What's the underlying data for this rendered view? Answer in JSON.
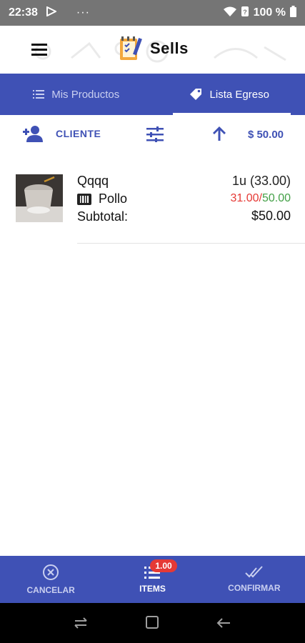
{
  "status_bar": {
    "time": "22:38",
    "overflow": "···",
    "battery_text": "100 %",
    "icons": [
      "play-store-icon",
      "wifi-icon",
      "signal-icon",
      "battery-icon"
    ]
  },
  "app_bar": {
    "title": "Sells",
    "menu_icon": "hamburger-menu-icon",
    "logo_icon": "notebook-pencil-icon"
  },
  "tabs": [
    {
      "label": "Mis Productos",
      "icon": "list-icon",
      "active": false
    },
    {
      "label": "Lista Egreso",
      "icon": "tag-icon",
      "active": true
    }
  ],
  "toolbar": {
    "cliente_label": "CLIENTE",
    "total": "$ 50.00"
  },
  "items": [
    {
      "name": "Qqqq",
      "quantity": "1u (33.00)",
      "category": "Pollo",
      "cost_price": "31.00",
      "separator": "/",
      "sale_price": "50.00",
      "subtotal_label": "Subtotal:",
      "subtotal_value": "$50.00"
    }
  ],
  "bottom_nav": {
    "cancel_label": "CANCELAR",
    "items_label": "ITEMS",
    "items_badge": "1.00",
    "confirm_label": "CONFIRMAR"
  },
  "colors": {
    "primary": "#3f51b5",
    "status_bar": "#757575",
    "cost_red": "#e53935",
    "sale_green": "#43a047"
  }
}
